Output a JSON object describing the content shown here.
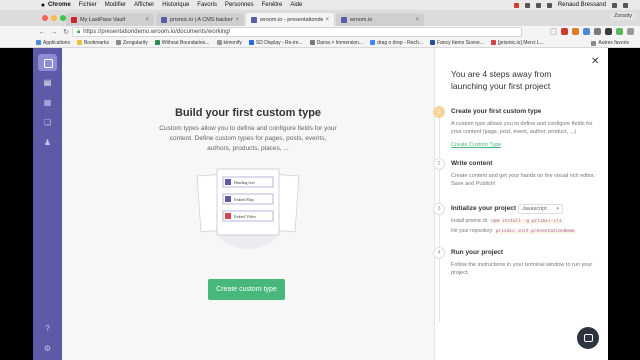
{
  "menubar": {
    "items": [
      "Chrome",
      "Fichier",
      "Modifier",
      "Afficher",
      "Historique",
      "Favoris",
      "Personnes",
      "Fenêtre",
      "Aide"
    ],
    "user": "Renaud Bressand",
    "zoom_label": "Zorsoly"
  },
  "tabs": [
    {
      "label": "My LastPass Vault",
      "color": "#c8282d"
    },
    {
      "label": "prismic.io | A CMS backend fo",
      "color": "#5d5ba8"
    },
    {
      "label": "wroom.io - presentationdemo",
      "color": "#5d5ba8"
    },
    {
      "label": "wroom.io",
      "color": "#5d5ba8"
    }
  ],
  "profile": "Renaud",
  "address": {
    "url": "https://presentationdemo.wroom.io/documents/working/"
  },
  "bookmarks": {
    "items": [
      "Applications",
      "Bookmarks",
      "Zengularity",
      "Without Boundaries...",
      "kimonify",
      "SD Display - Re-im...",
      "Darva > Immersion...",
      "drag n drop - Rech...",
      "Fancy Items Scene...",
      "[prismic.io] Merci L..."
    ],
    "other": "Autres favoris"
  },
  "main": {
    "title": "Build your first custom type",
    "description": "Custom types allow you to define and configure fields for your content. Define custom types for pages, posts, events, authors, products, places, ...",
    "illustration": {
      "rows": [
        "Heading text",
        "Embed Map",
        "Embed Video"
      ]
    },
    "cta_label": "Create custom type"
  },
  "panel": {
    "title": "You are 4 steps away from launching your first project",
    "steps": [
      {
        "number": "1",
        "title": "Create your first custom type",
        "description": "A custom type allows you to define and configure fields for your content (page, post, event, author, product, ...)",
        "link": "Create Custom Type"
      },
      {
        "number": "2",
        "title": "Write content",
        "description": "Create content and get your hands on the visual rich editor. Save and Publish!"
      },
      {
        "number": "3",
        "title": "Initialize your project",
        "select_value": "Javascript",
        "install_prefix": "Install prismic cli:",
        "install_cmd": "npm install -g prismic-cli",
        "init_prefix": "Init your repository:",
        "init_cmd": "prismic init presentationdemo"
      },
      {
        "number": "4",
        "title": "Run your project",
        "description": "Follow the instructions in your terminal window to run your project."
      }
    ]
  }
}
